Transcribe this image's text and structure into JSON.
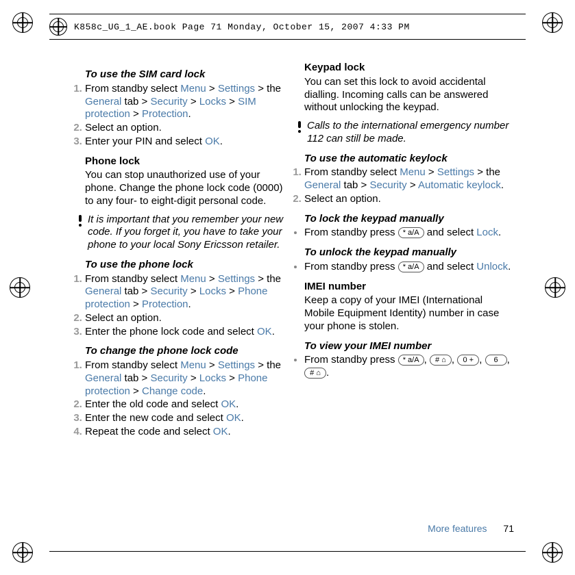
{
  "header": "K858c_UG_1_AE.book  Page 71  Monday, October 15, 2007  4:33 PM",
  "left": {
    "sim_title": "To use the SIM card lock",
    "sim_steps": {
      "s1a": "From standby select ",
      "s1_menu": "Menu",
      "s1_gt1": " > ",
      "s1_settings": "Settings",
      "s1b": " > the ",
      "s1_general": "General",
      "s1c": " tab > ",
      "s1_security": "Security",
      "s1d": " > ",
      "s1_locks": "Locks",
      "s1e": " > ",
      "s1_simprot": "SIM protection",
      "s1f": " > ",
      "s1_prot": "Protection",
      "s1g": ".",
      "s2": "Select an option.",
      "s3a": "Enter your PIN and select ",
      "s3_ok": "OK",
      "s3b": "."
    },
    "phone_head": "Phone lock",
    "phone_body": "You can stop unauthorized use of your phone. Change the phone lock code (0000) to any four- to eight-digit personal code.",
    "phone_note": "It is important that you remember your new code. If you forget it, you have to take your phone to your local Sony Ericsson retailer.",
    "use_phone_title": "To use the phone lock",
    "use_phone": {
      "s1a": "From standby select ",
      "s1_menu": "Menu",
      "s1d": " > ",
      "s1_settings": "Settings",
      "s1b": " > the ",
      "s1_general": "General",
      "s1c": " tab > ",
      "s1_security": "Security",
      "s1_locks": "Locks",
      "s1e": " > ",
      "s1_phoneprot": "Phone protection",
      "s1f": " > ",
      "s1_prot": "Protection",
      "s1g": ".",
      "s2": "Select an option.",
      "s3a": "Enter the phone lock code and select ",
      "s3_ok": "OK",
      "s3b": "."
    },
    "change_title": "To change the phone lock code",
    "change": {
      "s1a": "From standby select ",
      "s1_menu": "Menu",
      "s1d": " > ",
      "s1_settings": "Settings",
      "s1b": " > the ",
      "s1_general": "General",
      "s1c": " tab > ",
      "s1_security": "Security",
      "s1_locks": "Locks",
      "s1e": " > ",
      "s1_phoneprot": "Phone protection",
      "s1f": " > ",
      "s1_changecode": "Change code",
      "s1g": ".",
      "s2a": "Enter the old code and select ",
      "s2_ok": "OK",
      "s2b": ".",
      "s3a": "Enter the new code and select ",
      "s3_ok": "OK",
      "s3b": ".",
      "s4a": "Repeat the code and select ",
      "s4_ok": "OK",
      "s4b": "."
    }
  },
  "right": {
    "keypad_head": "Keypad lock",
    "keypad_body": "You can set this lock to avoid accidental dialling. Incoming calls can be answered without unlocking the keypad.",
    "keypad_note": "Calls to the international emergency number 112 can still be made.",
    "auto_title": "To use the automatic keylock",
    "auto": {
      "s1a": "From standby select ",
      "s1_menu": "Menu",
      "s1d": " > ",
      "s1_settings": "Settings",
      "s1b": " > the ",
      "s1_general": "General",
      "s1c": " tab > ",
      "s1_security": "Security",
      "s1e": " > ",
      "s1_autokey": "Automatic keylock",
      "s1g": ".",
      "s2": "Select an option."
    },
    "lock_title": "To lock the keypad manually",
    "lock_a": "From standby press ",
    "lock_b": " and select ",
    "lock_link": "Lock",
    "lock_c": ".",
    "unlock_title": "To unlock the keypad manually",
    "unlock_a": "From standby press ",
    "unlock_b": " and select ",
    "unlock_link": "Unlock",
    "unlock_c": ".",
    "imei_head": "IMEI number",
    "imei_body": "Keep a copy of your IMEI (International Mobile Equipment Identity) number in case your phone is stolen.",
    "imei_title": "To view your IMEI number",
    "imei_a": "From standby press ",
    "imei_b": ", ",
    "imei_c": ", ",
    "imei_d": ", ",
    "imei_e": ", ",
    "imei_f": ".",
    "key_star": "* a/A",
    "key_hash": "# ⌂",
    "key_0": "0 +",
    "key_6": "6"
  },
  "footer": {
    "label": "More features",
    "page": "71"
  }
}
